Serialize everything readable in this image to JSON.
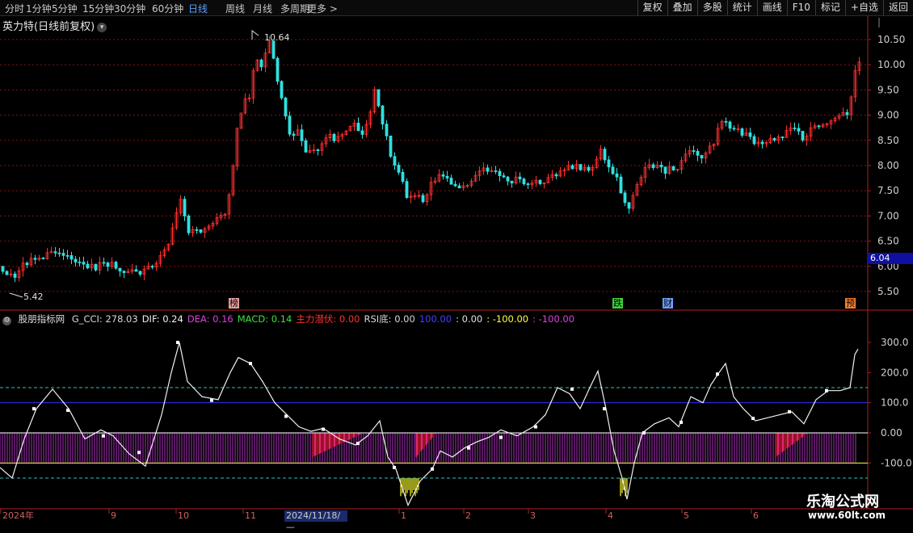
{
  "toolbar": {
    "periods": [
      "分时",
      "1分钟",
      "5分钟",
      "15分钟",
      "30分钟",
      "60分钟",
      "日线",
      "周线",
      "月线",
      "多周期",
      "更多 >"
    ],
    "active_period": "日线",
    "right_buttons": [
      "复权",
      "叠加",
      "多股",
      "统计",
      "画线",
      "F10",
      "标记",
      "+自选",
      "返回"
    ]
  },
  "chart_header": {
    "title": "英力特(日线前复权)",
    "dropdown_icon": "chevron-down-icon"
  },
  "price_axis": {
    "ticks": [
      "10.50",
      "10.00",
      "9.50",
      "9.00",
      "8.50",
      "8.00",
      "7.50",
      "7.00",
      "6.50",
      "6.00",
      "5.50"
    ],
    "current_price": "6.04"
  },
  "annotations": {
    "high": "10.64",
    "low": "5.42"
  },
  "event_markers": [
    {
      "label": "榜",
      "color": "#e8a0a0"
    },
    {
      "label": "跌",
      "color": "#40d040"
    },
    {
      "label": "财",
      "color": "#70a0ff"
    },
    {
      "label": "预",
      "color": "#ff8030"
    }
  ],
  "indicator": {
    "name": "股朋指标网",
    "items": [
      {
        "text": "G_CCI: 278.03",
        "color": "#d8d8d8"
      },
      {
        "text": "DIF: 0.24",
        "color": "#f0f0f0"
      },
      {
        "text": "DEA: 0.16",
        "color": "#e040e0"
      },
      {
        "text": "MACD: 0.14",
        "color": "#40e040"
      },
      {
        "text": "主力潜伏: 0.00",
        "color": "#ff3030"
      },
      {
        "text": "RSI底: 0.00",
        "color": "#d8d8d8"
      },
      {
        "text": "100.00",
        "color": "#4040ff"
      },
      {
        "text": ": 0.00",
        "color": "#e0e0e0"
      },
      {
        "text": ": -100.00",
        "color": "#ffff40"
      },
      {
        "text": ": -100.00",
        "color": "#e040e0"
      }
    ],
    "axis_ticks": [
      "300.0",
      "200.0",
      "100.0",
      "0.00",
      "-100.0"
    ]
  },
  "date_axis": {
    "labels": [
      "2024年",
      "9",
      "10",
      "11",
      "1",
      "2",
      "3",
      "4",
      "5",
      "6"
    ],
    "selected_date": "2024/11/18/—"
  },
  "watermark": {
    "line1": "乐淘公式网",
    "line2": "www.60lt.com"
  },
  "colors": {
    "up": "#ff3030",
    "down": "#30e0e0",
    "bg": "#000000",
    "grid": "#8a1010"
  }
}
